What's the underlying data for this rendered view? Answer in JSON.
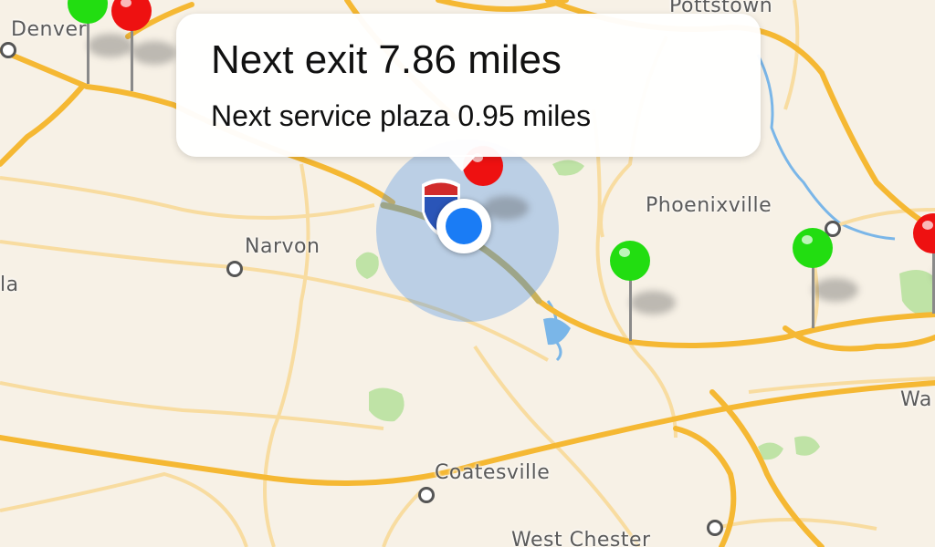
{
  "callout": {
    "line1": "Next exit 7.86 miles",
    "line2": "Next service plaza 0.95 miles"
  },
  "places": {
    "denver": "Denver",
    "pottstown": "Pottstown",
    "phoenixville": "Phoenixville",
    "narvon": "Narvon",
    "la": "la",
    "coatesville": "Coatesville",
    "west_chester": "West Chester",
    "wa": "Wa"
  },
  "colors": {
    "map_background": "#f7f1e6",
    "road_major": "#f5b833",
    "road_minor": "#f8dca0",
    "water": "#7ab6e8",
    "park": "#bfe3a6",
    "pin_green": "#22dd11",
    "pin_red": "#ee1111",
    "user_location": "#1a7cf5"
  },
  "markers": {
    "pins": [
      {
        "color": "green"
      },
      {
        "color": "red"
      },
      {
        "color": "green"
      },
      {
        "color": "green"
      },
      {
        "color": "red"
      }
    ],
    "interstate_shield": "interstate-shield-icon"
  }
}
